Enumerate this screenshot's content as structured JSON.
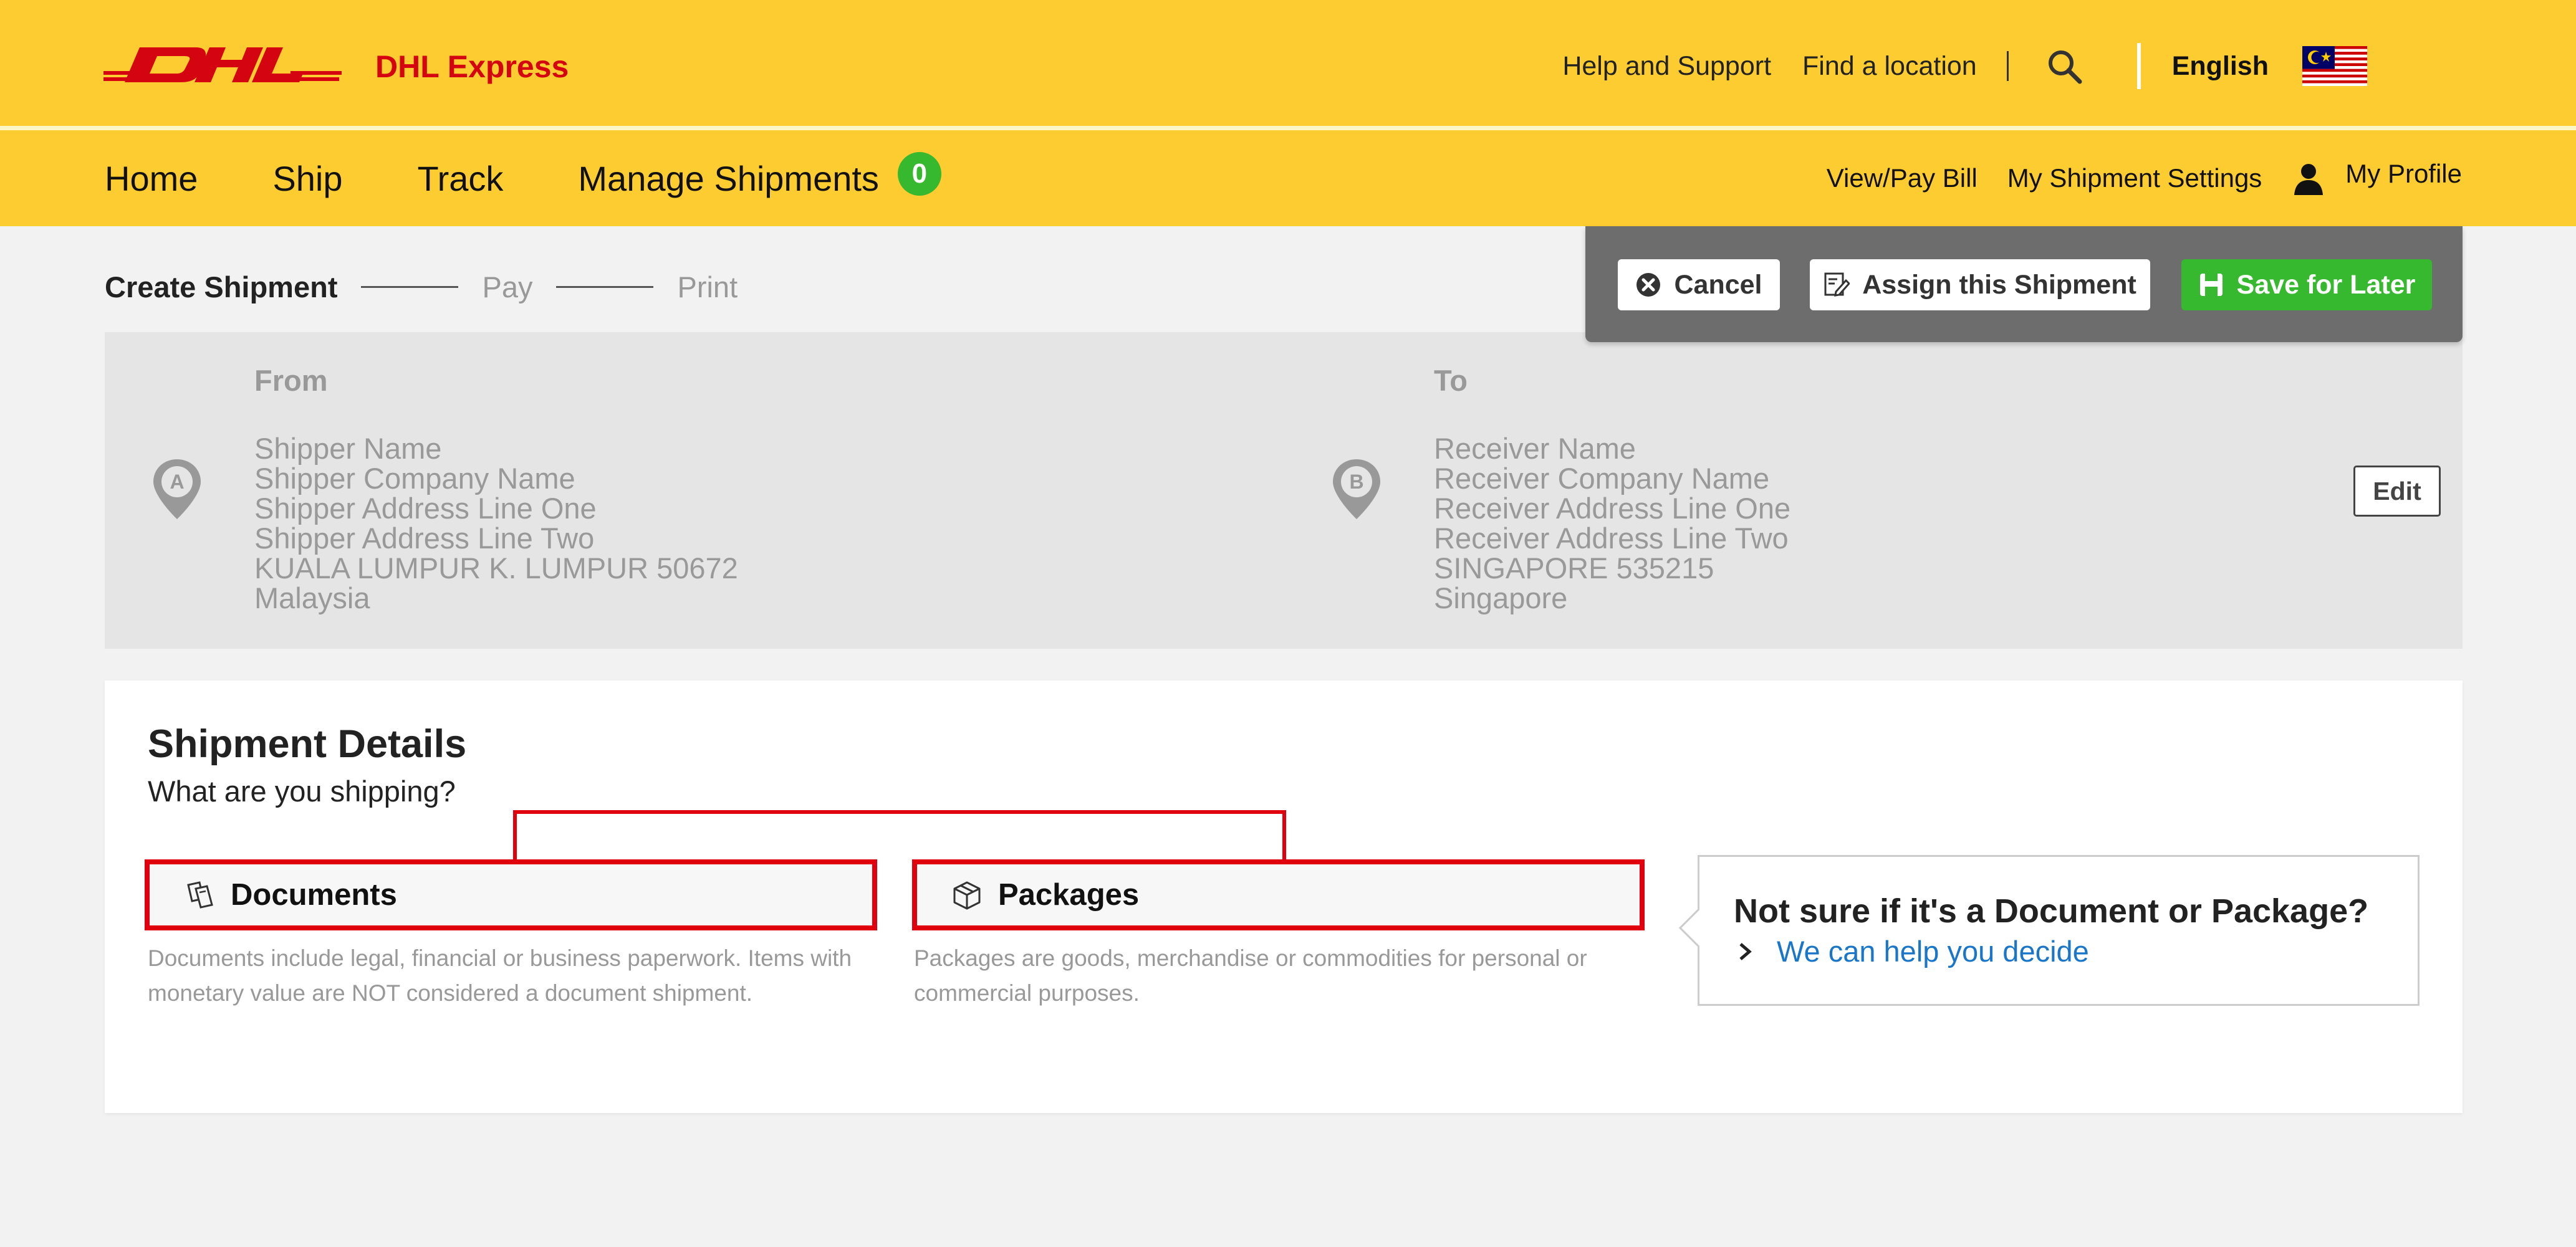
{
  "header": {
    "brand_name": "DHL Express",
    "links": [
      "Help and Support",
      "Find a location"
    ],
    "language": "English",
    "brand_red": "#d40511",
    "brand_yellow": "#fdcc30"
  },
  "nav": {
    "items": [
      "Home",
      "Ship",
      "Track",
      "Manage Shipments"
    ],
    "manage_count": "0",
    "right_links": [
      "View/Pay Bill",
      "My Shipment Settings"
    ],
    "profile": "My Profile"
  },
  "steps": [
    "Create Shipment",
    "Pay",
    "Print"
  ],
  "actions": {
    "cancel": "Cancel",
    "assign": "Assign this Shipment",
    "save": "Save for Later",
    "save_color": "#36b82f"
  },
  "from": {
    "heading": "From",
    "lines": [
      "Shipper Name",
      "Shipper Company Name",
      "Shipper Address Line One",
      "Shipper Address Line Two",
      "KUALA LUMPUR K. LUMPUR 50672",
      "Malaysia"
    ]
  },
  "to": {
    "heading": "To",
    "lines": [
      "Receiver Name",
      "Receiver Company Name",
      "Receiver Address Line One",
      "Receiver Address Line Two",
      "SINGAPORE 535215",
      "Singapore"
    ]
  },
  "address": {
    "edit_label": "Edit"
  },
  "details": {
    "title": "Shipment Details",
    "subtitle": "What are you shipping?",
    "documents": {
      "label": "Documents",
      "description": "Documents include legal, financial or business paperwork. Items with monetary value are NOT considered a document shipment."
    },
    "packages": {
      "label": "Packages",
      "description": "Packages are goods, merchandise or commodities for personal or commercial purposes."
    },
    "help": {
      "title": "Not sure if it's a Document or Package?",
      "link": "We can help you decide"
    }
  }
}
